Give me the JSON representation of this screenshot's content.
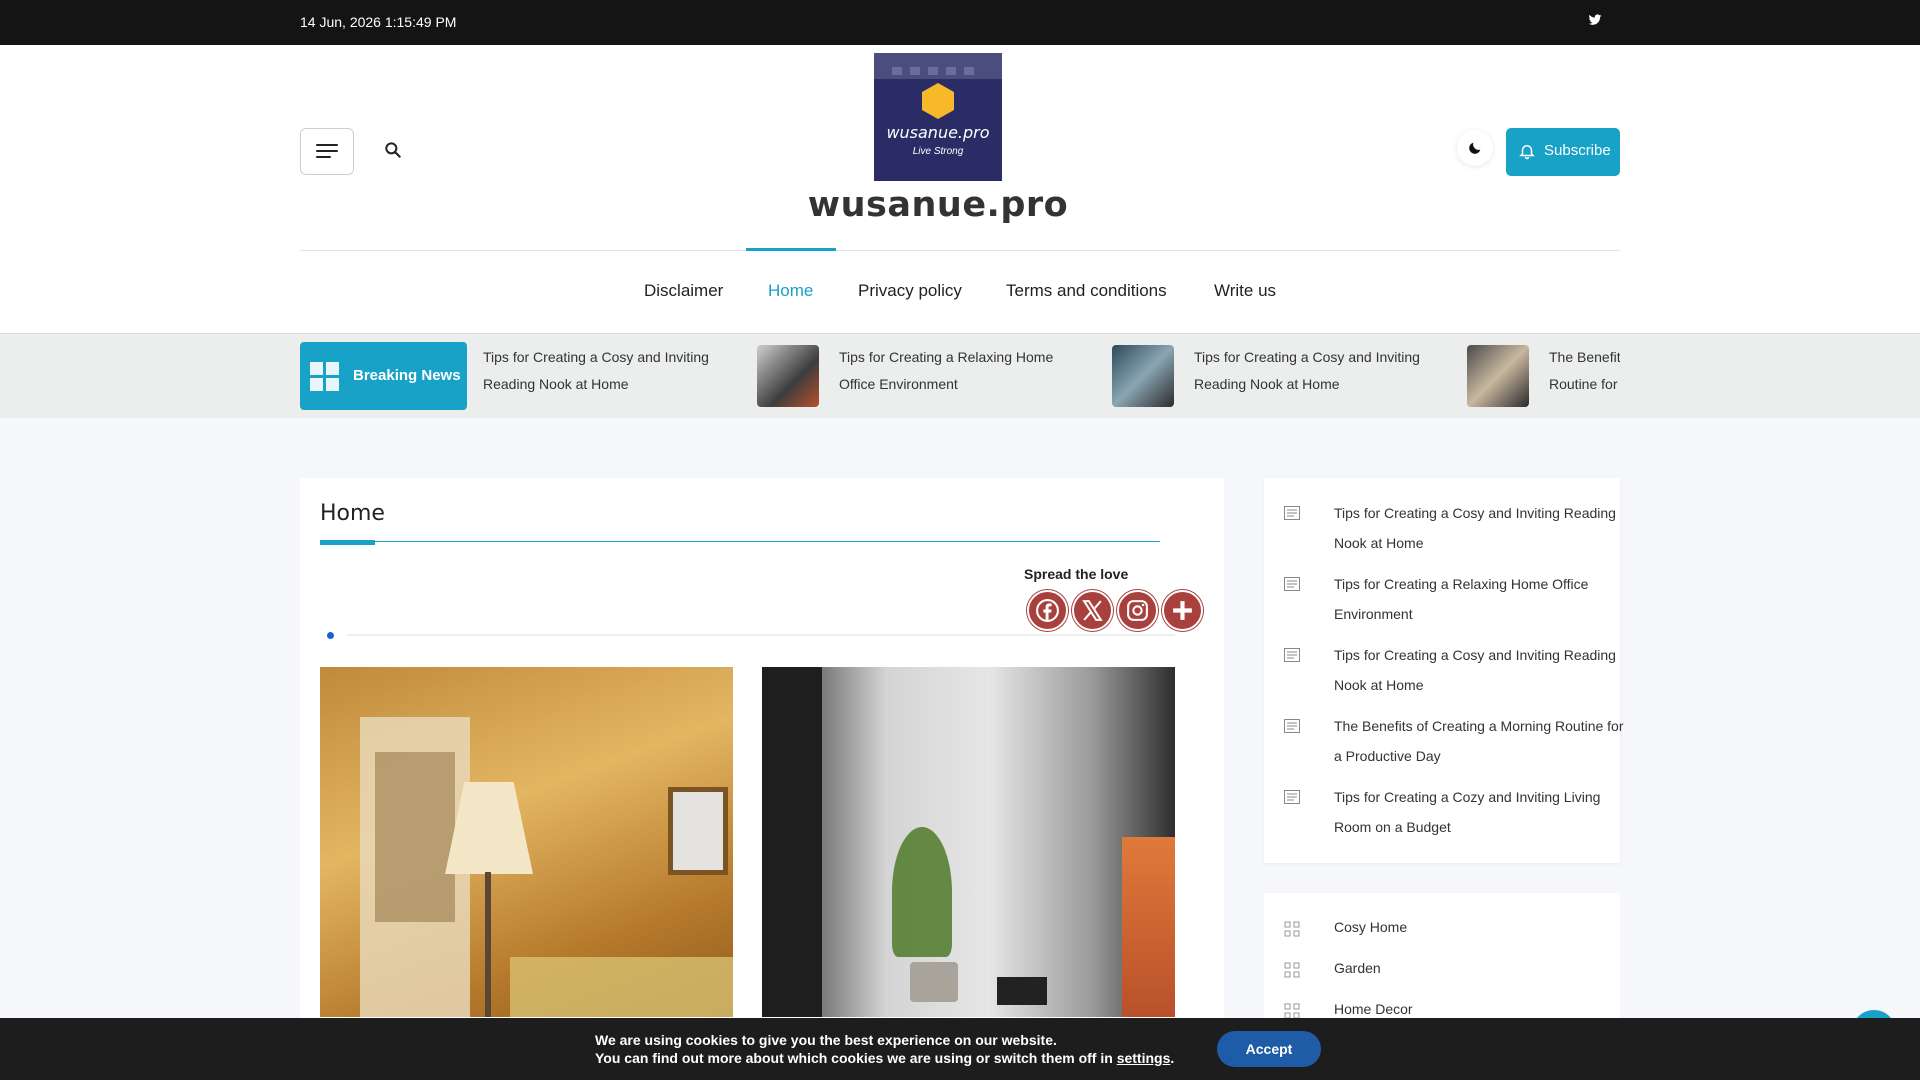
{
  "topbar": {
    "datetime": "14 Jun, 2026 1:15:49 PM",
    "social_icon": "twitter-icon"
  },
  "header": {
    "logo_name": "wusanue.pro",
    "logo_tagline": "Live Strong",
    "site_title": "wusanue.pro",
    "subscribe_label": "Subscribe"
  },
  "nav": {
    "items": [
      "Disclaimer",
      "Home",
      "Privacy policy",
      "Terms and conditions",
      "Write us"
    ],
    "active": "Home"
  },
  "ticker": {
    "label": "Breaking News",
    "items": [
      "Tips for Creating a Cosy and Inviting Reading Nook at Home",
      "Tips for Creating a Relaxing Home Office Environment",
      "Tips for Creating a Cosy and Inviting Reading Nook at Home",
      "The Benefits of Creating a Morning Routine for a Productive Day"
    ]
  },
  "main": {
    "heading": "Home",
    "spread_label": "Spread the love",
    "share_icons": [
      "facebook-icon",
      "x-icon",
      "instagram-icon",
      "plus-icon"
    ]
  },
  "sidebar": {
    "recent_posts": [
      "Tips for Creating a Cosy and Inviting Reading Nook at Home",
      "Tips for Creating a Relaxing Home Office Environment",
      "Tips for Creating a Cosy and Inviting Reading Nook at Home",
      "The Benefits of Creating a Morning Routine for a Productive Day",
      "Tips for Creating a Cozy and Inviting Living Room on a Budget"
    ],
    "categories": [
      "Cosy Home",
      "Garden",
      "Home Decor"
    ]
  },
  "cookie": {
    "line1": "We are using cookies to give you the best experience on our website.",
    "line2_prefix": "You can find out more about which cookies we are using or switch them off in ",
    "line2_link": "settings",
    "line2_suffix": ".",
    "accept_label": "Accept"
  },
  "colors": {
    "accent": "#18a2c8",
    "share": "#a8403d",
    "accept": "#1e5ca8"
  }
}
